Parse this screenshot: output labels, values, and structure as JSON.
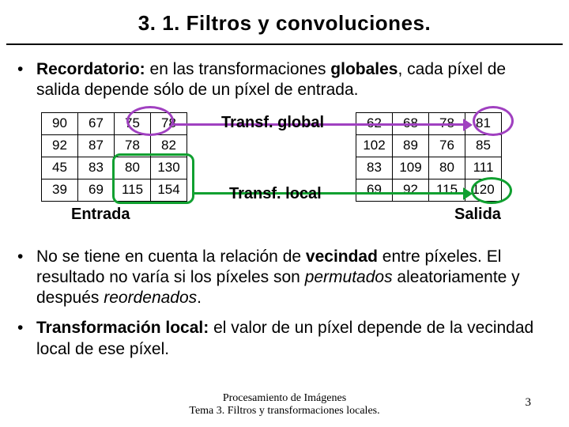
{
  "title": "3. 1. Filtros y convoluciones.",
  "bullets": {
    "b1_bold": "Recordatorio:",
    "b1_rest_a": " en las transformaciones ",
    "b1_globales": "globales",
    "b1_rest_b": ", cada píxel de salida depende sólo de un píxel de entrada.",
    "b2_a": "No se tiene en cuenta la relación de ",
    "b2_vec": "vecindad",
    "b2_b": " entre píxeles. El resultado no varía si los píxeles son ",
    "b2_perm": "permutados",
    "b2_c": " aleatoriamente y después ",
    "b2_reord": "reordenados",
    "b2_d": ".",
    "b3_bold": "Transformación local:",
    "b3_rest": " el valor de un píxel depende de la vecindad local de ese píxel."
  },
  "tables": {
    "left": [
      [
        "90",
        "67",
        "75",
        "78"
      ],
      [
        "92",
        "87",
        "78",
        "82"
      ],
      [
        "45",
        "83",
        "80",
        "130"
      ],
      [
        "39",
        "69",
        "115",
        "154"
      ]
    ],
    "right": [
      [
        "62",
        "68",
        "78",
        "81"
      ],
      [
        "102",
        "89",
        "76",
        "85"
      ],
      [
        "83",
        "109",
        "80",
        "111"
      ],
      [
        "69",
        "92",
        "115",
        "120"
      ]
    ],
    "cap_left": "Entrada",
    "cap_right": "Salida",
    "lbl_global": "Transf. global",
    "lbl_local": "Transf. local"
  },
  "footer": {
    "l1": "Procesamiento de Imágenes",
    "l2": "Tema 3. Filtros y transformaciones locales."
  },
  "page": "3"
}
